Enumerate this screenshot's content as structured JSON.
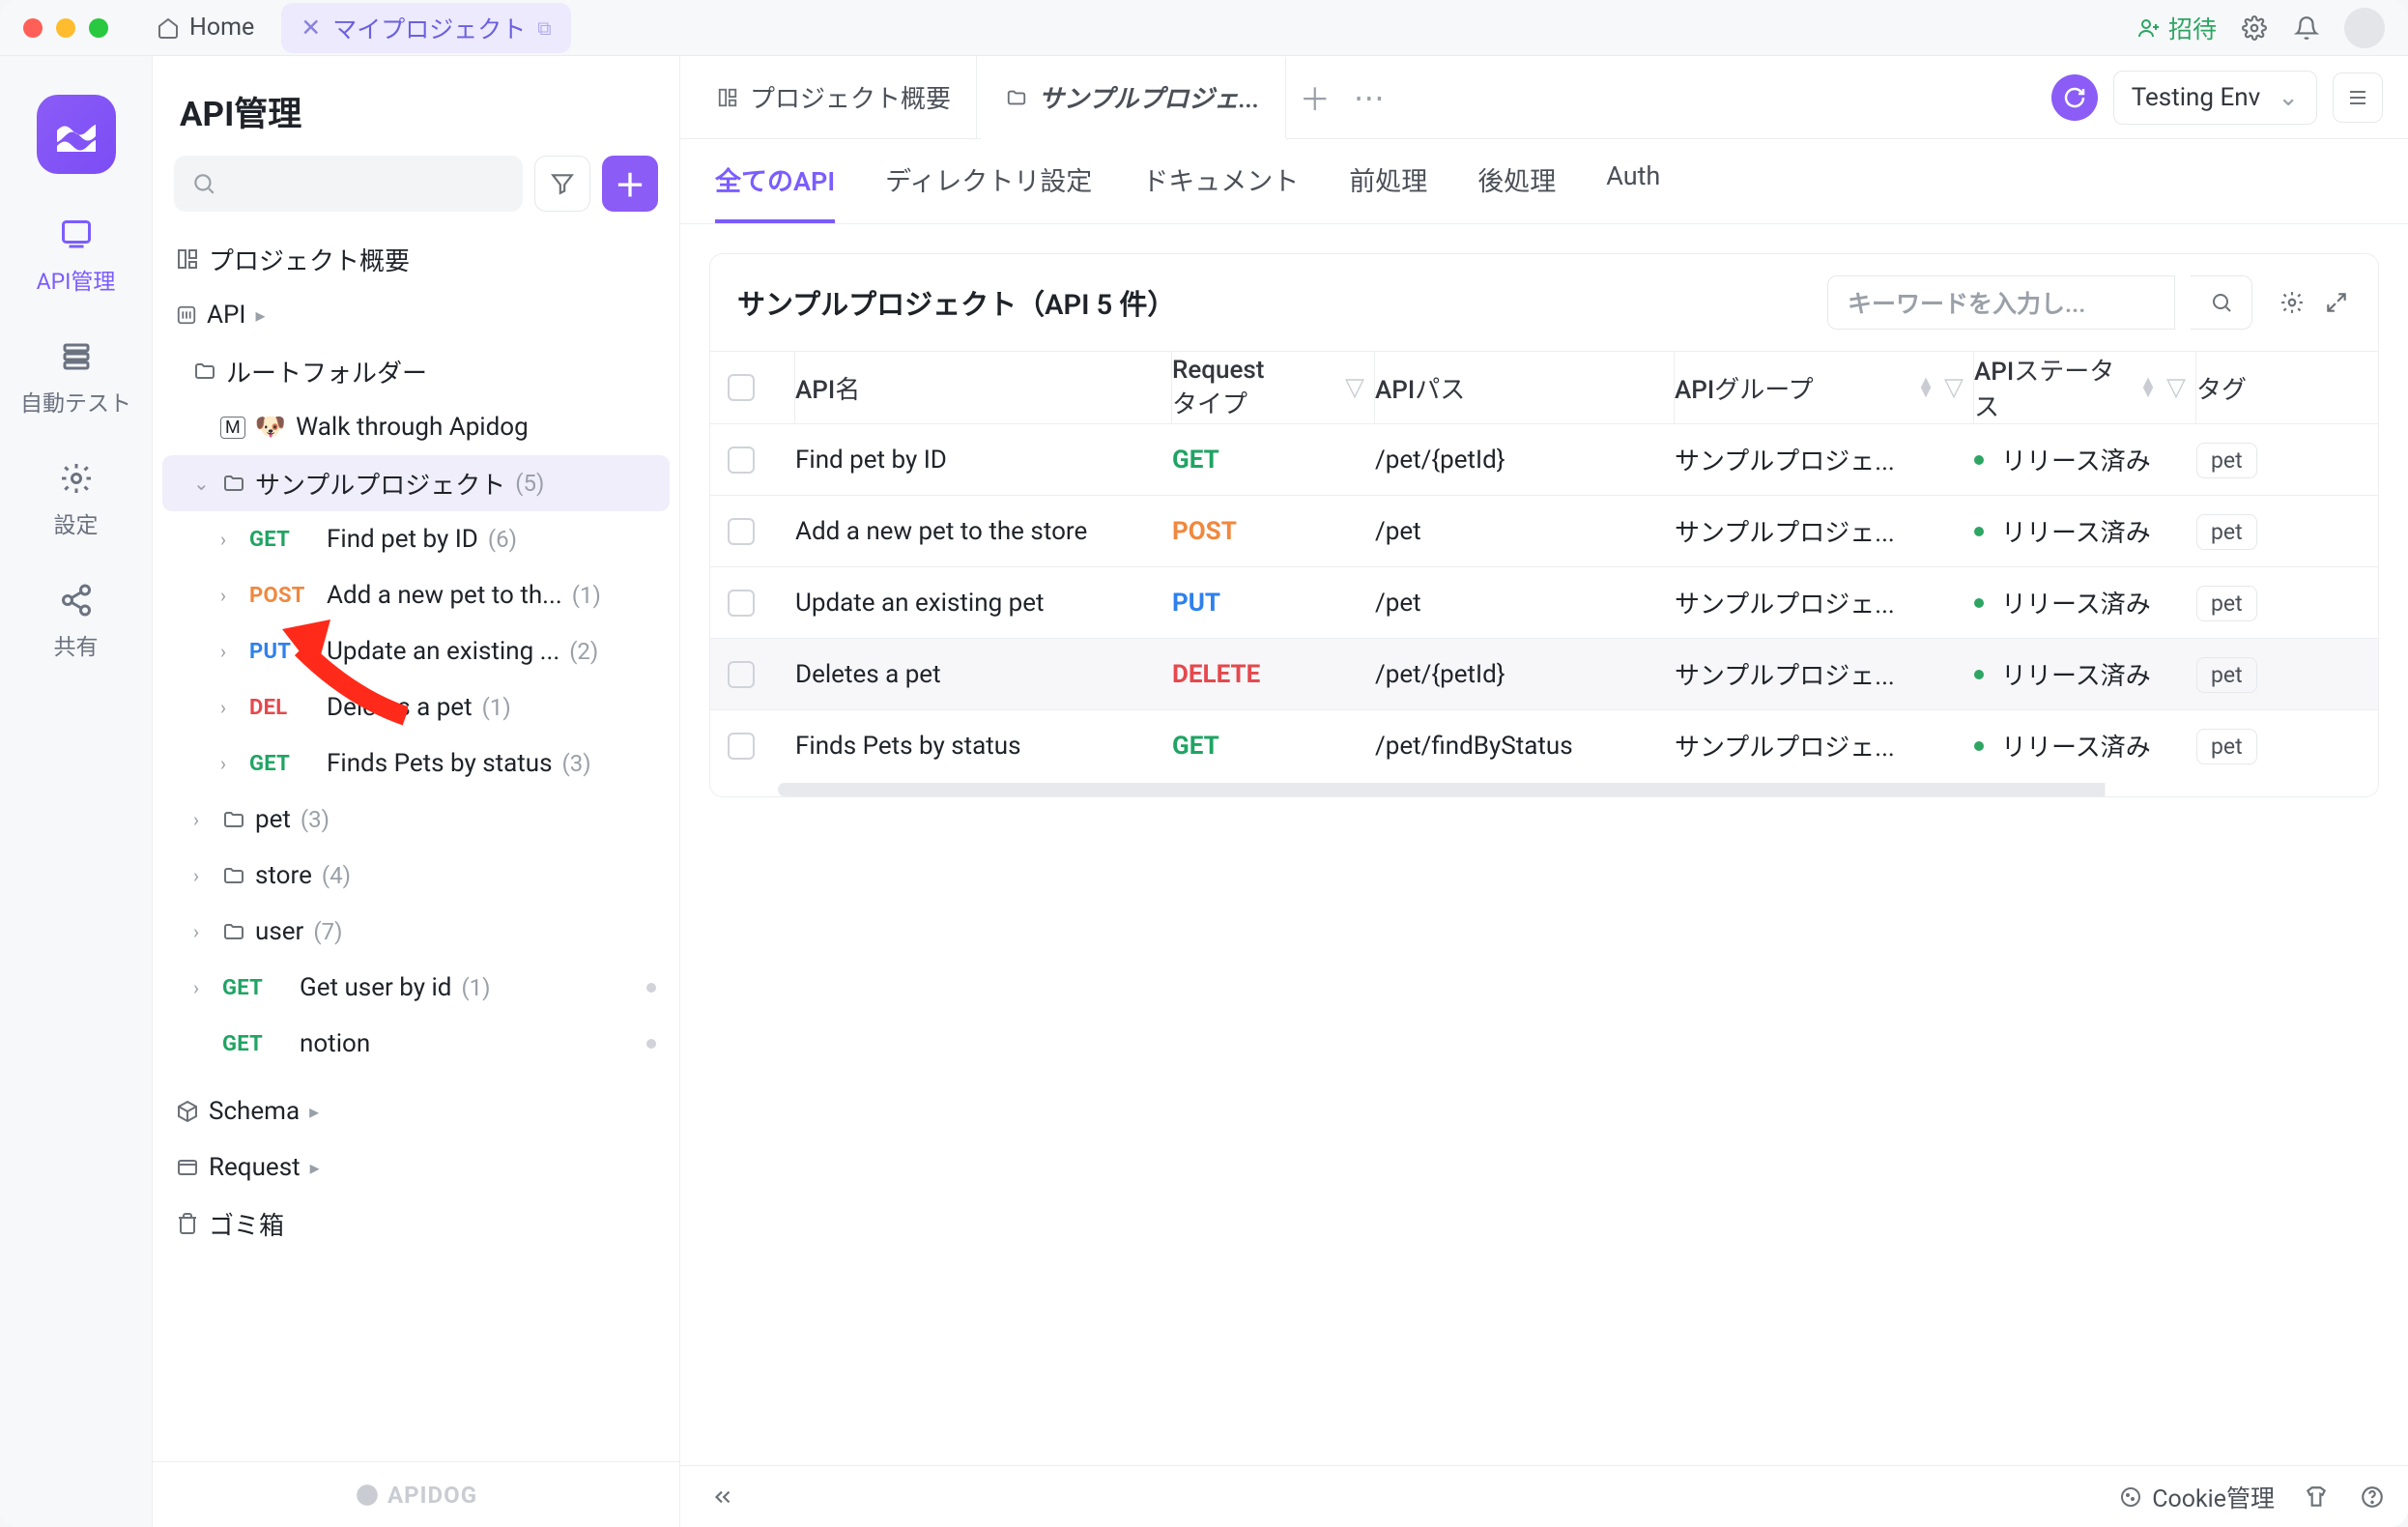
{
  "titlebar": {
    "home_label": "Home",
    "project_tab_label": "マイプロジェクト",
    "invite_label": "招待"
  },
  "rail": {
    "items": [
      {
        "label": "API管理"
      },
      {
        "label": "自動テスト"
      },
      {
        "label": "設定"
      },
      {
        "label": "共有"
      }
    ]
  },
  "panel": {
    "title": "API管理",
    "project_overview_label": "プロジェクト概要",
    "api_root_label": "API",
    "tree": {
      "root_folder": "ルートフォルダー",
      "walk_apidog": "Walk through Apidog",
      "sample_project": {
        "label": "サンプルプロジェクト",
        "count": "(5)"
      },
      "items": [
        {
          "method": "GET",
          "label": "Find pet by ID",
          "count": "(6)"
        },
        {
          "method": "POST",
          "label": "Add a new pet to th...",
          "count": "(1)"
        },
        {
          "method": "PUT",
          "label": "Update an existing ...",
          "count": "(2)"
        },
        {
          "method": "DEL",
          "label": "Deletes a pet",
          "count": "(1)"
        },
        {
          "method": "GET",
          "label": "Finds Pets by status",
          "count": "(3)"
        }
      ],
      "pet_folder": {
        "label": "pet",
        "count": "(3)"
      },
      "store_folder": {
        "label": "store",
        "count": "(4)"
      },
      "user_folder": {
        "label": "user",
        "count": "(7)"
      },
      "get_user": {
        "method": "GET",
        "label": "Get user by id",
        "count": "(1)"
      },
      "notion": {
        "method": "GET",
        "label": "notion"
      },
      "schema": "Schema",
      "request": "Request",
      "trash": "ゴミ箱"
    },
    "footer_brand": "APIDOG"
  },
  "main_tabs": {
    "overview": "プロジェクト概要",
    "active": "サンプルプロジェ..."
  },
  "env": {
    "label": "Testing Env"
  },
  "subtabs": [
    "全てのAPI",
    "ディレクトリ設定",
    "ドキュメント",
    "前処理",
    "後処理",
    "Auth"
  ],
  "card": {
    "title": "サンプルプロジェクト（API 5 件）",
    "search_placeholder": "キーワードを入力し..."
  },
  "table": {
    "headers": {
      "name": "API名",
      "reqtype": "Request\nタイプ",
      "path": "APIパス",
      "group": "APIグループ",
      "status": "APIステータス",
      "tag": "タグ"
    },
    "rows": [
      {
        "name": "Find pet by ID",
        "method": "GET",
        "path": "/pet/{petId}",
        "group": "サンプルプロジェ...",
        "status": "リリース済み",
        "tag": "pet"
      },
      {
        "name": "Add a new pet to the store",
        "method": "POST",
        "path": "/pet",
        "group": "サンプルプロジェ...",
        "status": "リリース済み",
        "tag": "pet"
      },
      {
        "name": "Update an existing pet",
        "method": "PUT",
        "path": "/pet",
        "group": "サンプルプロジェ...",
        "status": "リリース済み",
        "tag": "pet"
      },
      {
        "name": "Deletes a pet",
        "method": "DELETE",
        "path": "/pet/{petId}",
        "group": "サンプルプロジェ...",
        "status": "リリース済み",
        "tag": "pet"
      },
      {
        "name": "Finds Pets by status",
        "method": "GET",
        "path": "/pet/findByStatus",
        "group": "サンプルプロジェ...",
        "status": "リリース済み",
        "tag": "pet"
      }
    ]
  },
  "footer": {
    "cookie": "Cookie管理"
  },
  "method_colors": {
    "GET": "#1fa463",
    "POST": "#f0883e",
    "PUT": "#2f80ed",
    "DEL": "#e5484d",
    "DELETE": "#e5484d"
  }
}
